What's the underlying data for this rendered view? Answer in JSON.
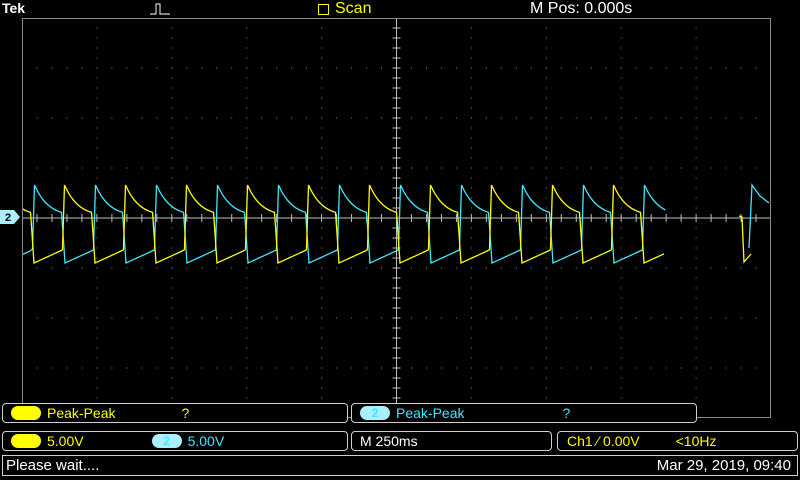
{
  "header": {
    "brand": "Tek",
    "acquisition_state": "Scan",
    "horizontal_position": "M Pos: 0.000s"
  },
  "channel_markers": {
    "ch2": "2"
  },
  "measurements": [
    {
      "channel": "1",
      "type": "Peak-Peak",
      "value": "?",
      "color": "#ffff00"
    },
    {
      "channel": "2",
      "type": "Peak-Peak",
      "value": "?",
      "color": "#40e8ff"
    }
  ],
  "vertical": {
    "ch1": {
      "label": "1",
      "scale": "5.00V"
    },
    "ch2": {
      "label": "2",
      "scale": "5.00V"
    }
  },
  "timebase": "M 250ms",
  "trigger": {
    "source": "Ch1",
    "slope_icon": "rising-edge-icon",
    "slope": "∕",
    "level": "0.00V",
    "frequency": "<10Hz"
  },
  "status": {
    "message": "Please wait....",
    "datetime": "Mar 29, 2019, 09:40"
  },
  "colors": {
    "ch1": "#ffff00",
    "ch2": "#40e8ff",
    "grid": "#8a8a8a"
  }
}
